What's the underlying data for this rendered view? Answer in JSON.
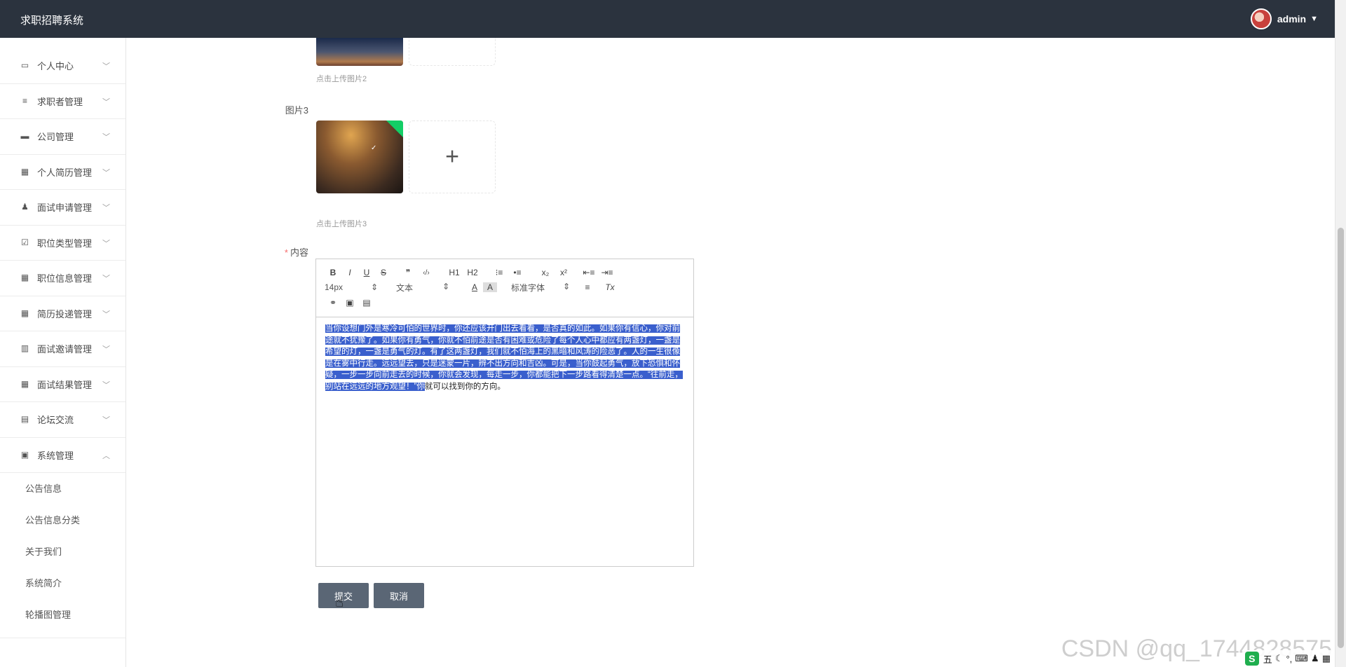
{
  "app": {
    "title": "求职招聘系统"
  },
  "user": {
    "name": "admin",
    "caret": "▼"
  },
  "sidebar": {
    "items": [
      {
        "label": "个人中心",
        "icon": "user-card-icon",
        "glyph": "▭"
      },
      {
        "label": "求职者管理",
        "icon": "list-icon",
        "glyph": "≡"
      },
      {
        "label": "公司管理",
        "icon": "chat-icon",
        "glyph": "▬"
      },
      {
        "label": "个人简历管理",
        "icon": "grid-icon",
        "glyph": "▦"
      },
      {
        "label": "面试申请管理",
        "icon": "person-icon",
        "glyph": "♟"
      },
      {
        "label": "职位类型管理",
        "icon": "checkbox-icon",
        "glyph": "☑"
      },
      {
        "label": "职位信息管理",
        "icon": "grid-icon",
        "glyph": "▦"
      },
      {
        "label": "简历投递管理",
        "icon": "grid-icon",
        "glyph": "▦"
      },
      {
        "label": "面试邀请管理",
        "icon": "bar-chart-icon",
        "glyph": "▥"
      },
      {
        "label": "面试结果管理",
        "icon": "grid-icon",
        "glyph": "▦"
      },
      {
        "label": "论坛交流",
        "icon": "briefcase-icon",
        "glyph": "▤"
      },
      {
        "label": "系统管理",
        "icon": "clipboard-icon",
        "glyph": "▣"
      }
    ],
    "submenu": [
      "公告信息",
      "公告信息分类",
      "关于我们",
      "系统简介",
      "轮播图管理"
    ]
  },
  "form": {
    "hint2": "点击上传图片2",
    "label_pic3": "图片3",
    "hint3": "点击上传图片3",
    "label_content": "内容",
    "required_mark": "*",
    "plus": "+",
    "check": "✓"
  },
  "editor": {
    "font_size": "14px",
    "header_select": "文本",
    "font_family": "标准字体",
    "toolbar_buttons": [
      "B",
      "I",
      "U",
      "S",
      "❞",
      "‹/›",
      "H1",
      "H2",
      "⁝≡",
      "•≡",
      "x₂",
      "x²",
      "⇤≡",
      "⇥≡"
    ],
    "selected_text": "当你设想门外是寒冷可怕的世界时，你还应该开门出去看看，是否真的如此。如果你有信心，你对前途就不犹豫了。如果你有勇气，你就不怕前途是否有困难或危险了每个人心中都应有两盏灯，一盏是希望的灯，一盏是勇气的灯。有了这两盏灯，我们就不怕海上的黑暗和风涛的险恶了。人的一生很像是在雾中行走。远远望去，只是迷蒙一片，辨不出方向和吉凶。可是，当你鼓起勇气，放下恐惧和怀疑，一步一步向前走去的时候，你就会发现，每走一步，你都能把下一步路看得清楚一点。“往前走，别站在远远的地方观望！”你",
    "unselected_text": "就可以找到你的方向。"
  },
  "buttons": {
    "submit": "提交",
    "cancel": "取消"
  },
  "watermark": "CSDN @qq_1744828575",
  "tray": {
    "logo": "S",
    "items": [
      "五",
      "☾",
      "°,",
      "⌨",
      "♟",
      "▦"
    ]
  }
}
